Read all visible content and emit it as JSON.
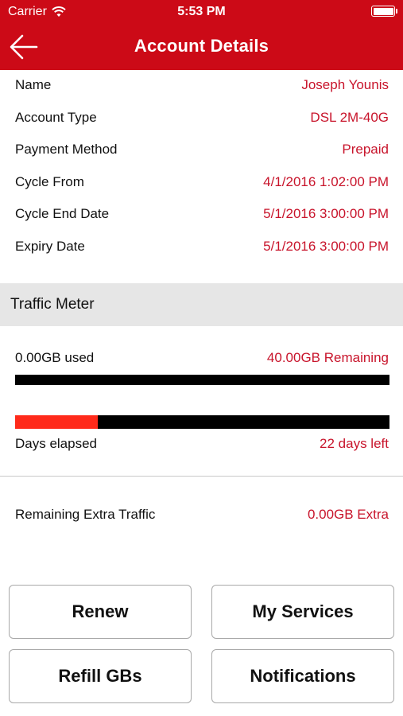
{
  "status_bar": {
    "carrier": "Carrier",
    "time": "5:53 PM"
  },
  "nav": {
    "title": "Account Details",
    "back_icon": "back-arrow-icon"
  },
  "details": [
    {
      "label": "Name",
      "value": "Joseph Younis"
    },
    {
      "label": "Account Type",
      "value": "DSL 2M-40G"
    },
    {
      "label": "Payment Method",
      "value": "Prepaid"
    },
    {
      "label": "Cycle From",
      "value": "4/1/2016 1:02:00 PM"
    },
    {
      "label": "Cycle End Date",
      "value": "5/1/2016 3:00:00 PM"
    },
    {
      "label": "Expiry Date",
      "value": "5/1/2016 3:00:00 PM"
    }
  ],
  "traffic_meter": {
    "title": "Traffic Meter",
    "used_label": "0.00GB used",
    "remaining_label": "40.00GB Remaining",
    "usage_fraction": 0,
    "days_label": "Days elapsed",
    "days_left_label": "22 days left",
    "days_fraction": 0.22
  },
  "extra": {
    "label": "Remaining Extra Traffic",
    "value": "0.00GB Extra"
  },
  "buttons": {
    "renew": "Renew",
    "my_services": "My Services",
    "refill": "Refill GBs",
    "notifications": "Notifications"
  },
  "colors": {
    "brand": "#cc0a17",
    "accent_text": "#c8142b",
    "progress_fill": "#ff2a1a",
    "bar": "#000000"
  }
}
